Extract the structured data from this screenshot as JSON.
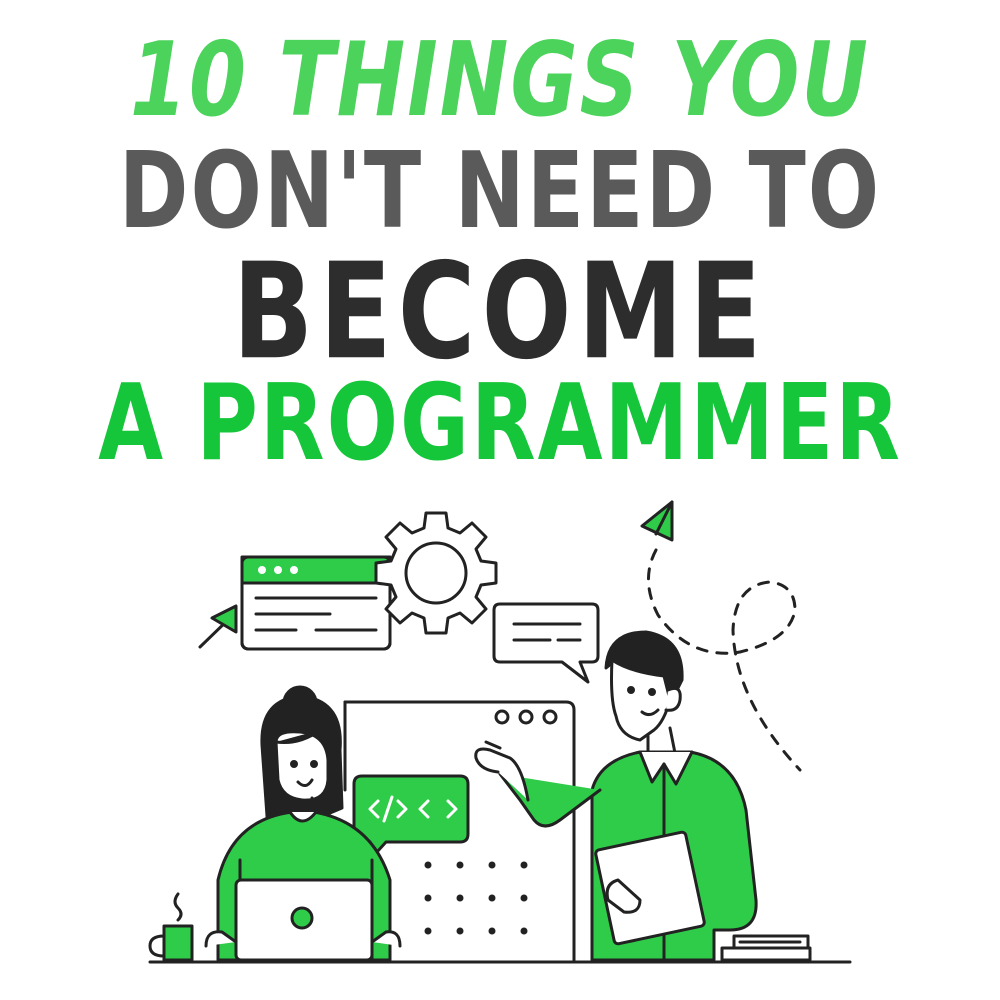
{
  "title": {
    "line1": "10 THINGS YOU",
    "line2": "DON'T NEED TO",
    "line3": "BECOME",
    "line4": "A PROGRAMMER"
  },
  "illustration": {
    "code_bubble_text": "</>  </>",
    "colors": {
      "accent": "#2fcc4a",
      "ink": "#222222",
      "skin": "#ffffff"
    }
  }
}
